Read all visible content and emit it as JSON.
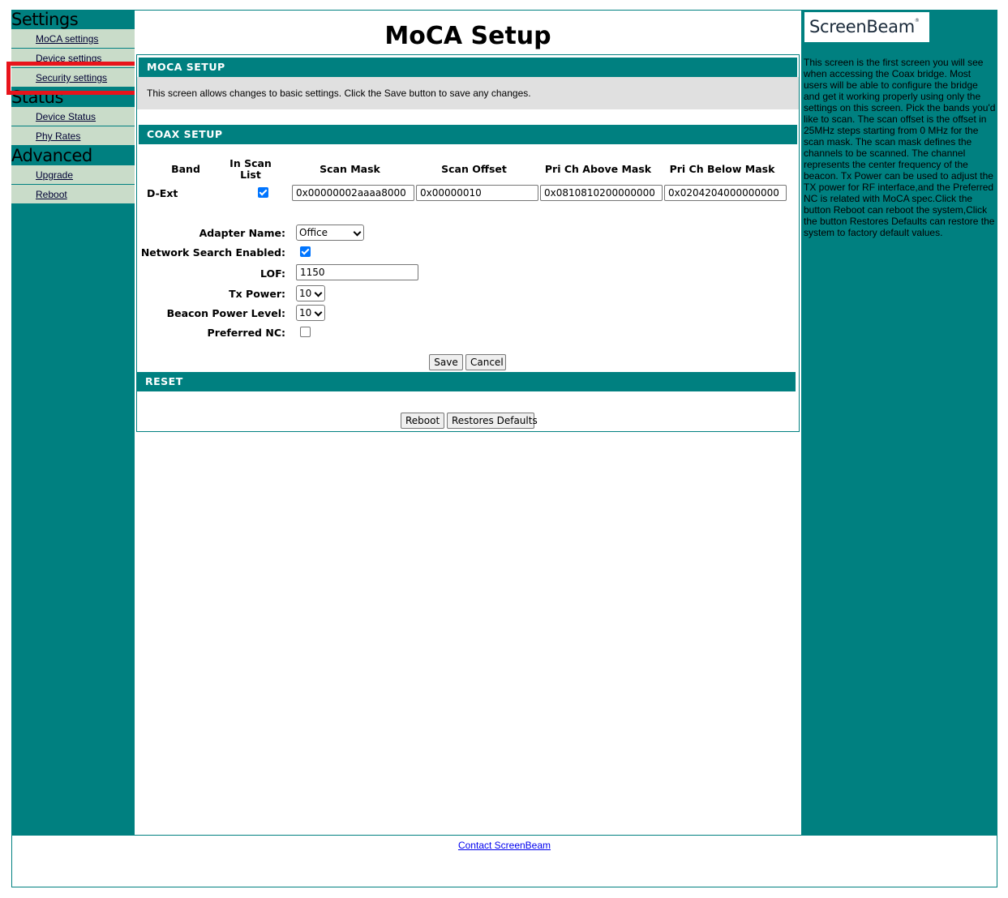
{
  "sidebar": {
    "sections": [
      {
        "title": "Settings",
        "items": [
          {
            "label": "MoCA settings"
          },
          {
            "label": "Device settings"
          },
          {
            "label": "Security settings"
          }
        ]
      },
      {
        "title": "Status",
        "items": [
          {
            "label": "Device Status"
          },
          {
            "label": "Phy Rates"
          }
        ]
      },
      {
        "title": "Advanced",
        "items": [
          {
            "label": "Upgrade"
          },
          {
            "label": "Reboot"
          }
        ]
      }
    ]
  },
  "main": {
    "title": "MoCA Setup",
    "moca_setup": {
      "header": "MOCA SETUP",
      "description": "This screen allows changes to basic settings. Click the Save button to save any changes."
    },
    "coax_setup": {
      "header": "COAX SETUP",
      "columns": [
        "Band",
        "In Scan List",
        "Scan Mask",
        "Scan Offset",
        "Pri Ch Above Mask",
        "Pri Ch Below Mask"
      ],
      "row": {
        "band": "D-Ext",
        "in_scan_list": true,
        "scan_mask": "0x00000002aaaa8000",
        "scan_offset": "0x00000010",
        "pri_ch_above_mask": "0x0810810200000000",
        "pri_ch_below_mask": "0x0204204000000000"
      },
      "form": {
        "adapter_name_label": "Adapter Name:",
        "adapter_name_value": "Office",
        "network_search_label": "Network Search Enabled:",
        "network_search_checked": true,
        "lof_label": "LOF:",
        "lof_value": "1150",
        "tx_power_label": "Tx Power:",
        "tx_power_value": "10",
        "beacon_power_label": "Beacon Power Level:",
        "beacon_power_value": "10",
        "preferred_nc_label": "Preferred NC:",
        "preferred_nc_checked": false
      },
      "save_label": "Save",
      "cancel_label": "Cancel"
    },
    "reset": {
      "header": "RESET",
      "reboot_label": "Reboot",
      "restore_label": "Restores Defaults"
    }
  },
  "right_panel": {
    "logo": "ScreenBeam",
    "logo_mark": "®",
    "help_text": "This screen is the first screen you will see when accessing the Coax bridge. Most users will be able to configure the bridge and get it working properly using only the settings on this screen. Pick the bands you'd like to scan. The scan offset is the offset in 25MHz steps starting from 0 MHz for the scan mask. The scan mask defines the channels to be scanned. The channel represents the center frequency of the beacon. Tx Power can be used to adjust the TX power for RF interface,and the Preferred NC is related with MoCA spec.Click the button Reboot can reboot the system,Click the button Restores Defaults can restore the system to factory default values."
  },
  "footer": {
    "link": "Contact ScreenBeam"
  },
  "colors": {
    "teal": "#008080",
    "nav_item_bg": "#c9dcc9",
    "highlight": "#e8141b",
    "checkbox": "#0075ff"
  }
}
